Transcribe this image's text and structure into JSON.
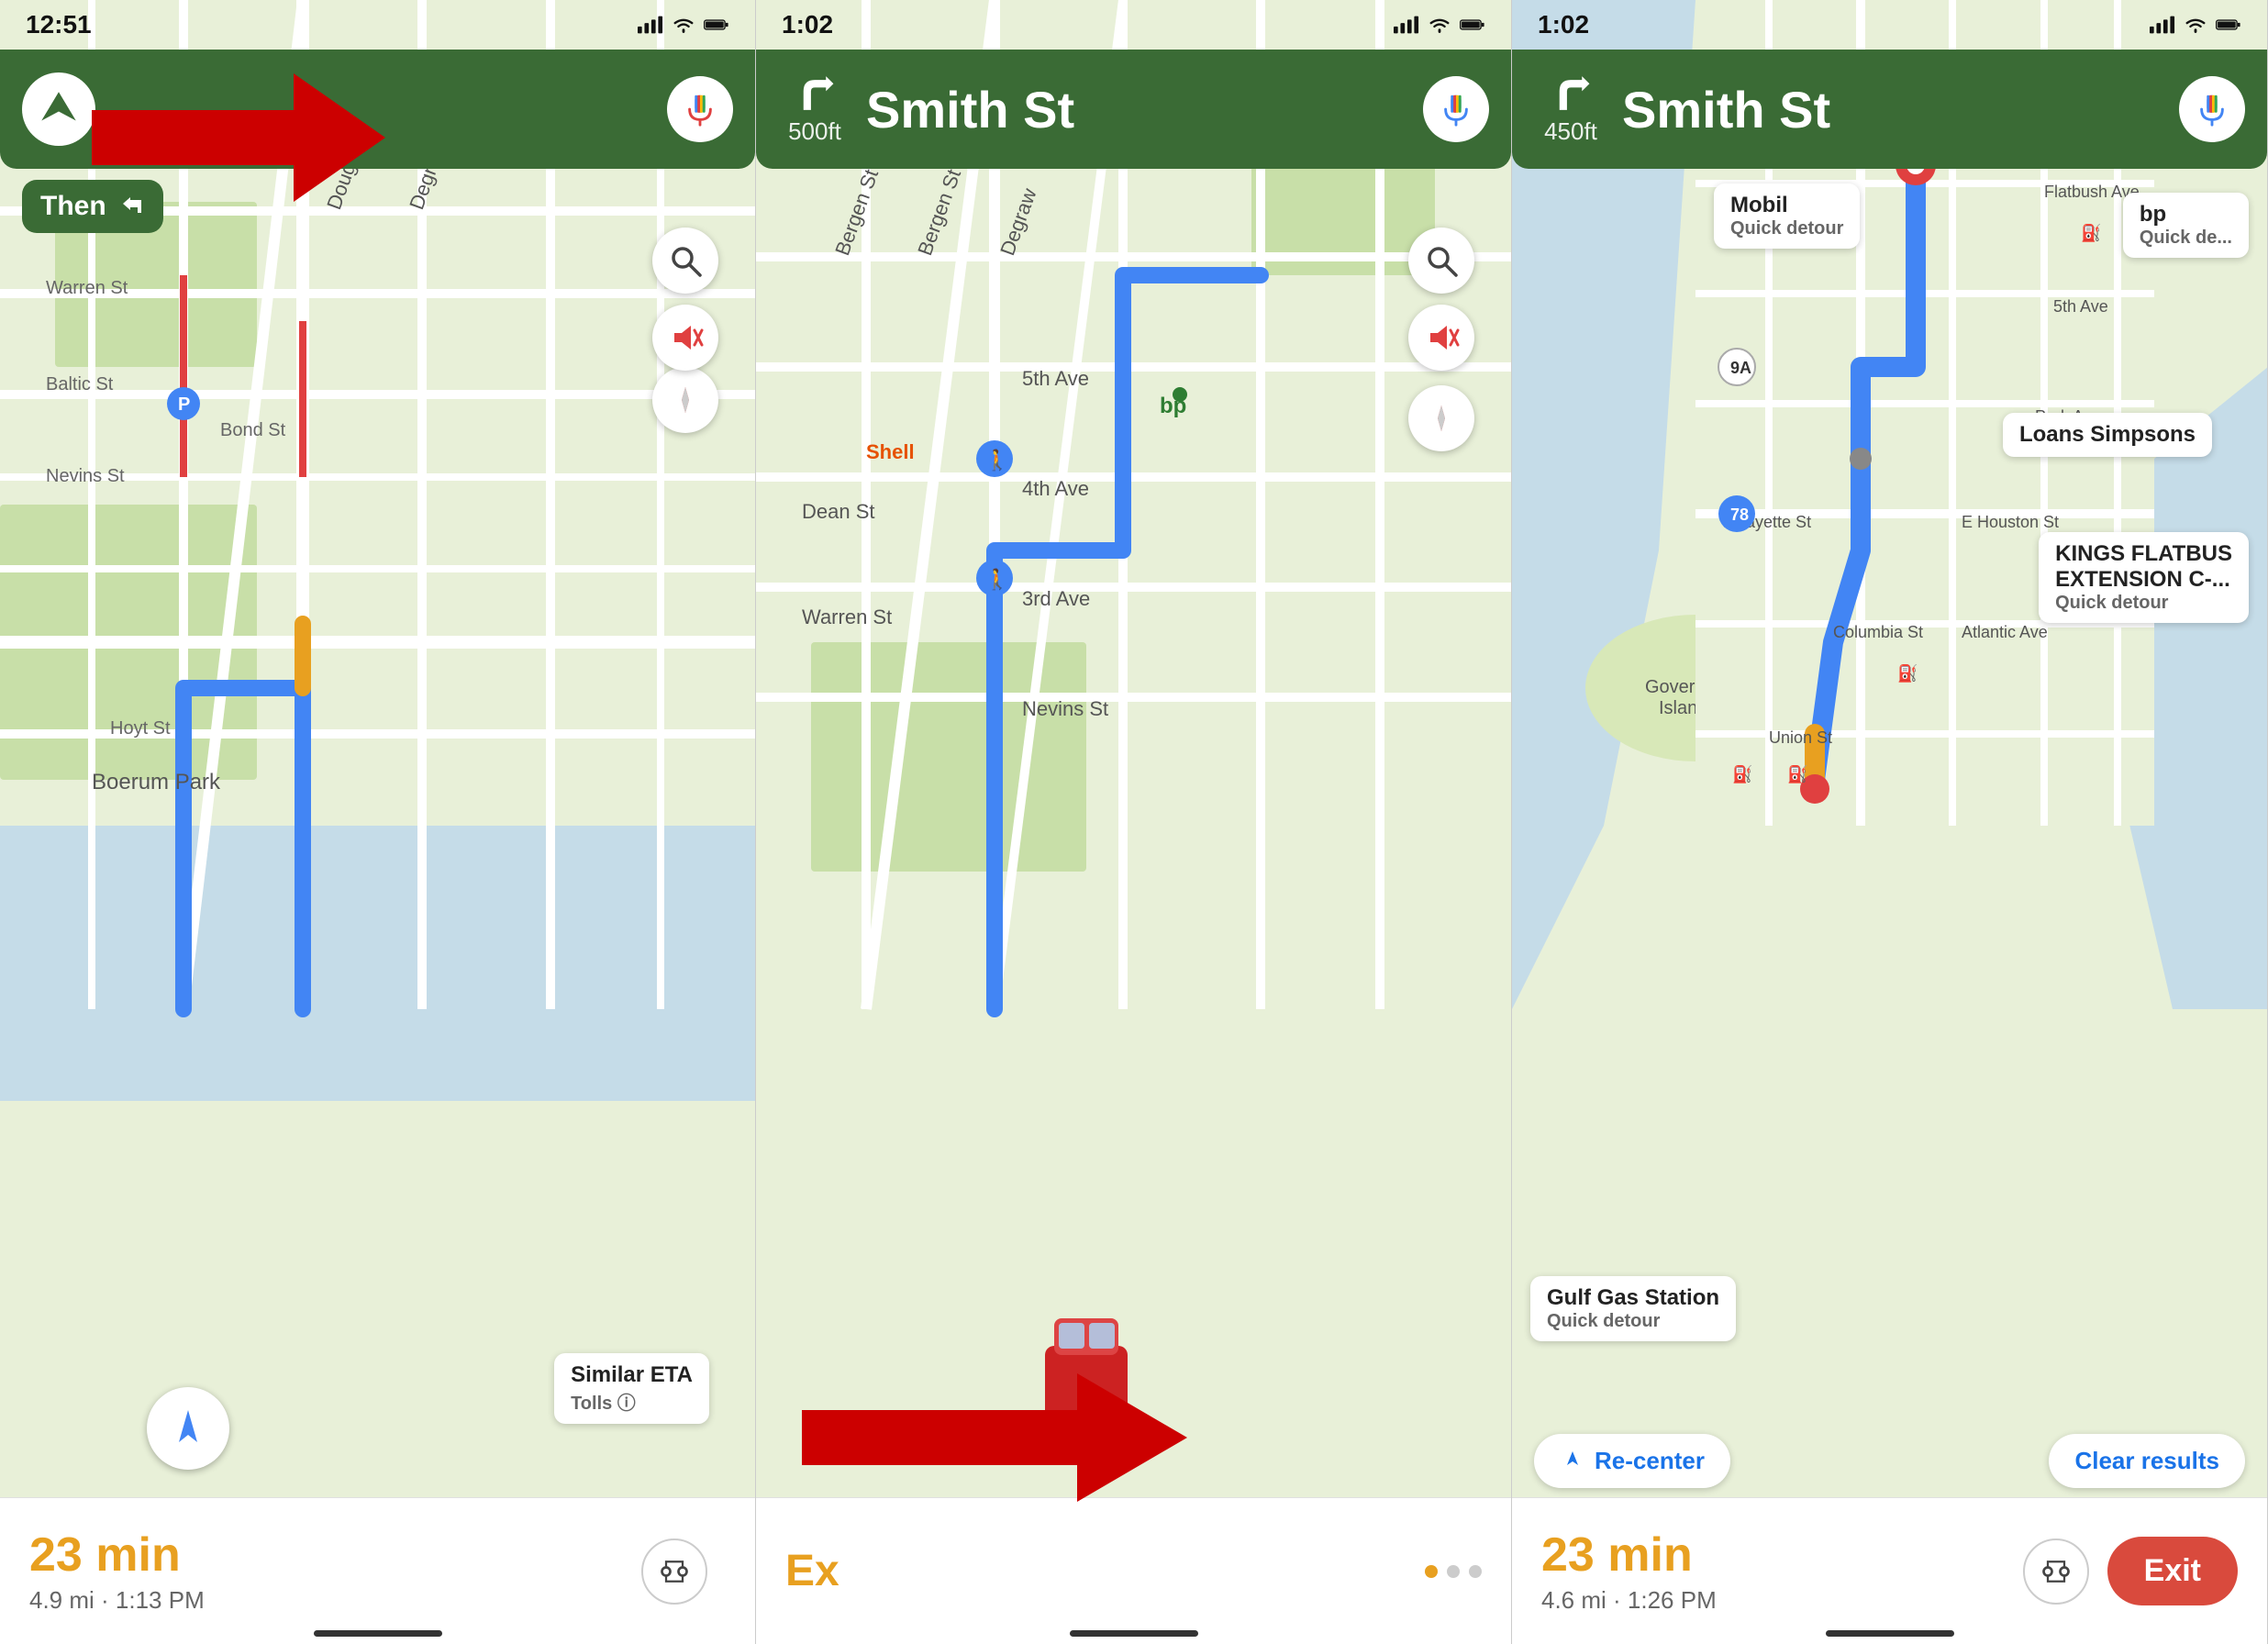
{
  "panel1": {
    "status": {
      "time": "12:51",
      "location_arrow": true
    },
    "nav": {
      "distance": "",
      "street": "",
      "mic_label": "mic"
    },
    "then_label": "Then",
    "map": {
      "callout_title": "Similar ETA",
      "callout_sub": "Tolls ⓘ",
      "location_label": "Boerum Park"
    },
    "bottom": {
      "eta_time": "23 min",
      "eta_details": "4.9 mi · 1:13 PM"
    }
  },
  "panel2": {
    "status": {
      "time": "1:02"
    },
    "nav": {
      "distance": "500ft",
      "street": "Smith St",
      "mic_label": "mic"
    },
    "bottom": {
      "eta_time": "",
      "exit_partial": "Ex"
    },
    "dots": [
      "orange",
      "gray",
      "gray"
    ]
  },
  "panel3": {
    "status": {
      "time": "1:02"
    },
    "nav": {
      "distance": "450ft",
      "street": "Smith St",
      "mic_label": "mic"
    },
    "callouts": [
      {
        "title": "Mobil",
        "sub": "Quick detour"
      },
      {
        "title": "bp",
        "sub": "Quick de..."
      },
      {
        "title": "Loans Simpsons",
        "sub": ""
      },
      {
        "title": "KINGS FLATBUS\nEXTENSION C-...",
        "sub": "Quick detour"
      },
      {
        "title": "Gulf Gas Station",
        "sub": "Quick detour"
      }
    ],
    "bottom": {
      "eta_time": "23 min",
      "eta_details": "4.6 mi · 1:26 PM",
      "exit_label": "Exit"
    },
    "recenter_label": "Re-center",
    "clear_label": "Clear results"
  },
  "icons": {
    "mic_blue": "🎙",
    "mic_google": "mic",
    "arrow_up": "↑",
    "turn_right": "↱",
    "route_options": "⇄"
  }
}
